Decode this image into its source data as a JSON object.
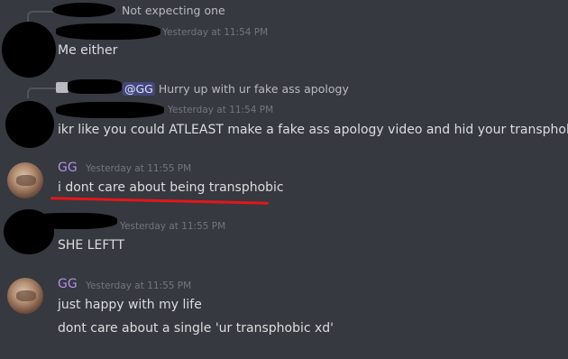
{
  "messages": [
    {
      "reply": {
        "text": "Not expecting one"
      },
      "timestamp": "Yesterday at 11:54 PM",
      "lines": [
        "Me either"
      ]
    },
    {
      "reply": {
        "mention": "@GG",
        "text": "Hurry up with ur fake ass apology"
      },
      "timestamp": "Yesterday at 11:54 PM",
      "lines": [
        "ikr like you could ATLEAST make a fake ass apology video and hid your transphobia"
      ]
    },
    {
      "username": "GG",
      "timestamp": "Yesterday at 11:55 PM",
      "lines": [
        "i dont care about being transphobic"
      ]
    },
    {
      "timestamp": "Yesterday at 11:55 PM",
      "lines": [
        "SHE LEFTT"
      ]
    },
    {
      "username": "GG",
      "timestamp": "Yesterday at 11:55 PM",
      "lines": [
        "just happy with my life",
        "dont care about a single 'ur transphobic xd'"
      ]
    }
  ],
  "colors": {
    "background": "#36393f",
    "username_gg": "#b68ee6",
    "annotation_underline": "#e3161c"
  }
}
